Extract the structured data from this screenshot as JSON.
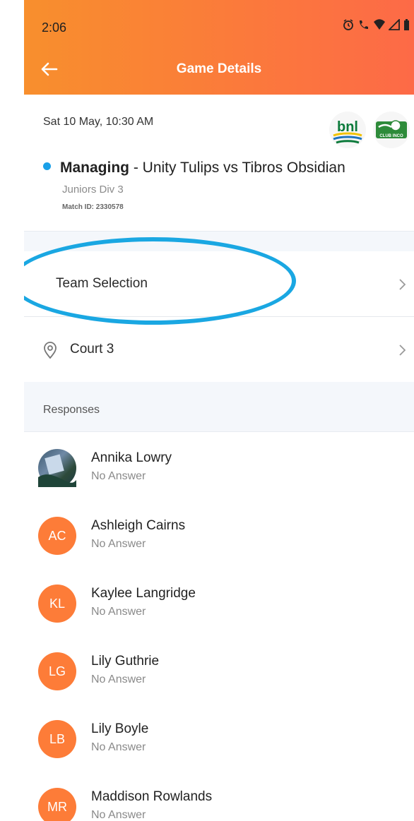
{
  "status_bar": {
    "time": "2:06"
  },
  "header": {
    "title": "Game Details"
  },
  "match": {
    "datetime": "Sat 10 May, 10:30 AM",
    "role": "Managing",
    "separator": " - ",
    "teams": "Unity Tulips vs Tibros Obsidian",
    "division": "Juniors Div 3",
    "match_id": "Match ID: 2330578",
    "logo_left_text": "bnl",
    "logo_right_text": "CLUB INCO"
  },
  "menu": {
    "team_selection": "Team Selection",
    "court": "Court 3"
  },
  "responses": {
    "heading": "Responses",
    "people": [
      {
        "name": "Annika Lowry",
        "status": "No Answer",
        "initials": ""
      },
      {
        "name": "Ashleigh Cairns",
        "status": "No Answer",
        "initials": "AC"
      },
      {
        "name": "Kaylee Langridge",
        "status": "No Answer",
        "initials": "KL"
      },
      {
        "name": "Lily Guthrie",
        "status": "No Answer",
        "initials": "LG"
      },
      {
        "name": "Lily Boyle",
        "status": "No Answer",
        "initials": "LB"
      },
      {
        "name": "Maddison Rowlands",
        "status": "No Answer",
        "initials": "MR"
      }
    ]
  },
  "colors": {
    "accent": "#fd7c38",
    "highlight_ring": "#1aa7e2",
    "status_dot": "#1aa0e8"
  }
}
